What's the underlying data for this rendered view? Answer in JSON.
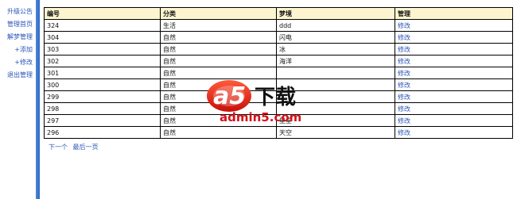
{
  "sidebar": {
    "items": [
      {
        "label": "升级公告"
      },
      {
        "label": "管理首页"
      },
      {
        "label": "解梦管理"
      },
      {
        "label": "+添加"
      },
      {
        "label": "+修改"
      },
      {
        "label": "退出管理"
      }
    ]
  },
  "table": {
    "headers": [
      "编号",
      "分类",
      "梦境",
      "管理"
    ],
    "rows": [
      {
        "id": "324",
        "category": "生活",
        "dream": "ddd",
        "action": "修改"
      },
      {
        "id": "304",
        "category": "自然",
        "dream": "闪电",
        "action": "修改"
      },
      {
        "id": "303",
        "category": "自然",
        "dream": "冰",
        "action": "修改"
      },
      {
        "id": "302",
        "category": "自然",
        "dream": "海洋",
        "action": "修改"
      },
      {
        "id": "301",
        "category": "自然",
        "dream": "",
        "action": "修改"
      },
      {
        "id": "300",
        "category": "自然",
        "dream": "",
        "action": "修改"
      },
      {
        "id": "299",
        "category": "自然",
        "dream": "",
        "action": "修改"
      },
      {
        "id": "298",
        "category": "自然",
        "dream": "",
        "action": "修改"
      },
      {
        "id": "297",
        "category": "自然",
        "dream": "星星",
        "action": "修改"
      },
      {
        "id": "296",
        "category": "自然",
        "dream": "天空",
        "action": "修改"
      }
    ]
  },
  "pager": {
    "next": "下一个",
    "last": "最后一页"
  },
  "watermark": {
    "logo_text": "a5",
    "brand_text": "下载",
    "url_text": "admin5.com"
  }
}
